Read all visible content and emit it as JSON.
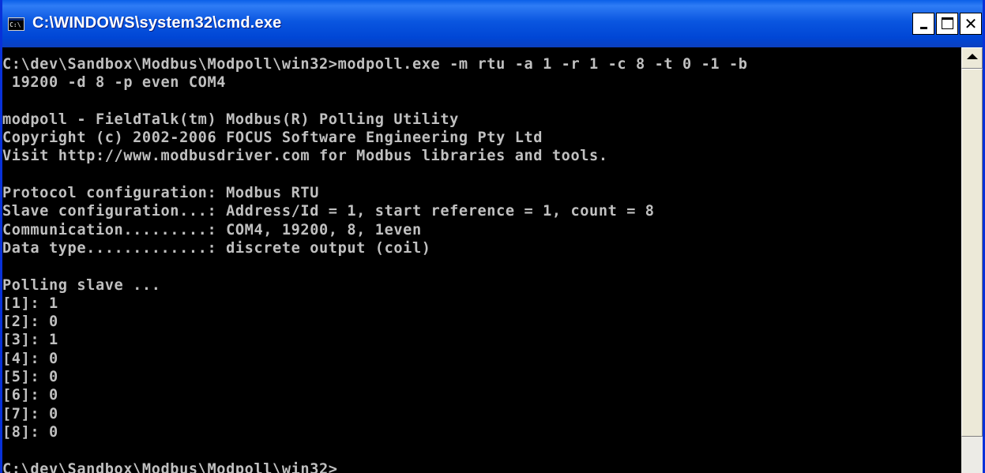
{
  "window": {
    "title": "C:\\WINDOWS\\system32\\cmd.exe",
    "icon_text": "C:\\",
    "controls": {
      "minimize_icon": "minimize-icon",
      "maximize_icon": "maximize-icon",
      "close_icon": "close-icon",
      "close_glyph": "✕"
    }
  },
  "colors": {
    "titlebar": "#0046d5",
    "console_background": "#000000",
    "console_text": "#c0c0c0"
  },
  "console": {
    "lines": [
      "C:\\dev\\Sandbox\\Modbus\\Modpoll\\win32>modpoll.exe -m rtu -a 1 -r 1 -c 8 -t 0 -1 -b",
      " 19200 -d 8 -p even COM4",
      "",
      "modpoll - FieldTalk(tm) Modbus(R) Polling Utility",
      "Copyright (c) 2002-2006 FOCUS Software Engineering Pty Ltd",
      "Visit http://www.modbusdriver.com for Modbus libraries and tools.",
      "",
      "Protocol configuration: Modbus RTU",
      "Slave configuration...: Address/Id = 1, start reference = 1, count = 8",
      "Communication.........: COM4, 19200, 8, 1even",
      "Data type.............: discrete output (coil)",
      "",
      "Polling slave ...",
      "[1]: 1",
      "[2]: 0",
      "[3]: 1",
      "[4]: 0",
      "[5]: 0",
      "[6]: 0",
      "[7]: 0",
      "[8]: 0",
      "",
      "C:\\dev\\Sandbox\\Modbus\\Modpoll\\win32>"
    ]
  }
}
